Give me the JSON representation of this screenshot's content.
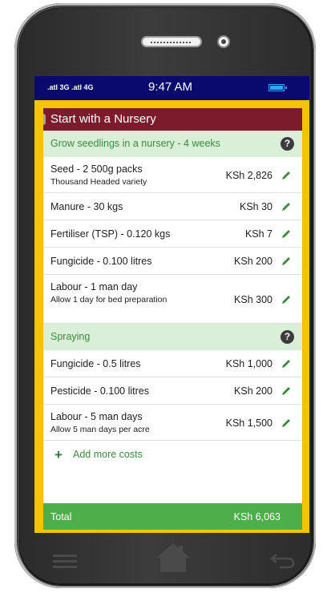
{
  "status": {
    "signal": ".atl 3G .atl 4G",
    "time": "9:47 AM"
  },
  "app": {
    "title": "Start with a Nursery",
    "sections": [
      {
        "title": "Grow seedlings in a nursery - 4 weeks",
        "items": [
          {
            "name": "Seed - 2 500g packs",
            "note": "Thousand Headed variety",
            "price": "KSh 2,826"
          },
          {
            "name": "Manure - 30 kgs",
            "note": "",
            "price": "KSh 30"
          },
          {
            "name": "Fertiliser (TSP) - 0.120 kgs",
            "note": "",
            "price": "KSh 7"
          },
          {
            "name": "Fungicide - 0.100 litres",
            "note": "",
            "price": "KSh 200"
          },
          {
            "name": "Labour - 1 man day",
            "note": "Allow 1 day for bed preparation",
            "price": "KSh 300"
          }
        ]
      },
      {
        "title": "Spraying",
        "items": [
          {
            "name": "Fungicide - 0.5 litres",
            "note": "",
            "price": "KSh 1,000"
          },
          {
            "name": "Pesticide - 0.100 litres",
            "note": "",
            "price": "KSh 200"
          },
          {
            "name": "Labour - 5 man days",
            "note": "Allow 5 man days per acre",
            "price": "KSh 1,500"
          }
        ]
      }
    ],
    "add_label": "Add more costs",
    "total_label": "Total",
    "total_value": "KSh 6,063",
    "colors": {
      "title_bar": "#7c1b2c",
      "frame": "#f5c400",
      "section": "#d9efd7",
      "total": "#4daf4a",
      "status_bar": "#0a0a6e"
    }
  }
}
